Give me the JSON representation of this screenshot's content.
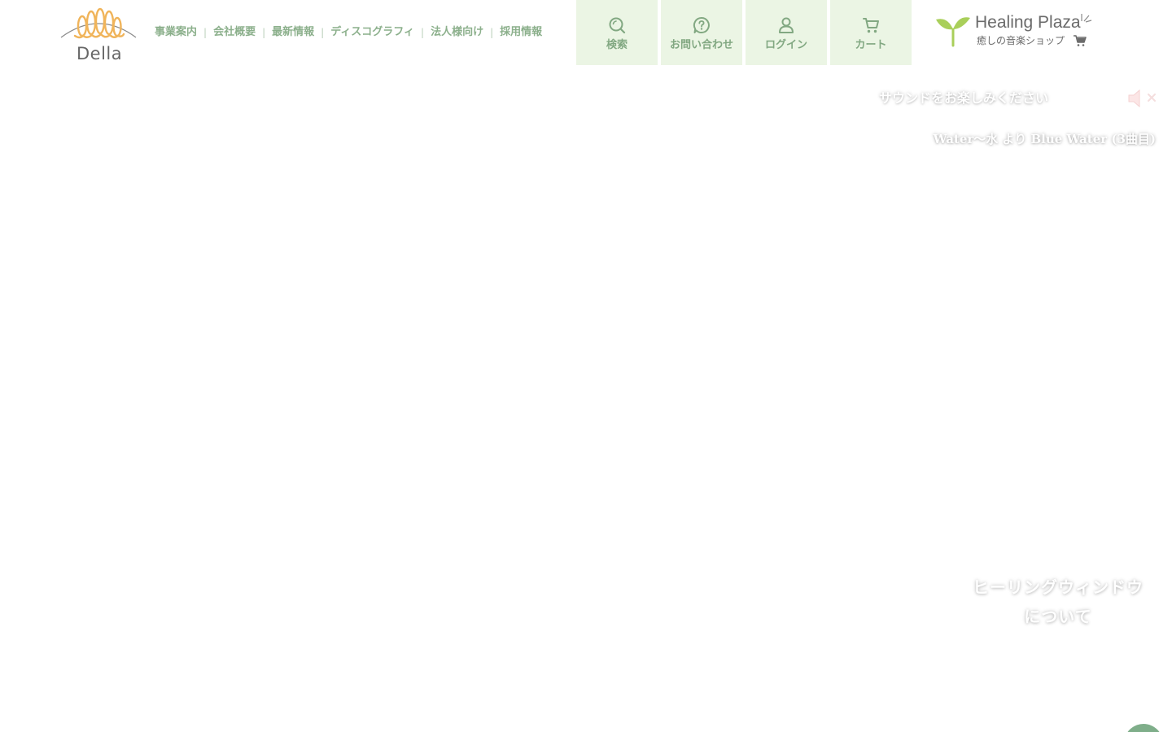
{
  "header": {
    "logo": {
      "text": "Della",
      "icon": "della-logo-swirl"
    },
    "nav": [
      {
        "label": "事業案内"
      },
      {
        "label": "会社概要"
      },
      {
        "label": "最新情報"
      },
      {
        "label": "ディスコグラフィ"
      },
      {
        "label": "法人様向け"
      },
      {
        "label": "採用情報"
      }
    ],
    "nav_separator": "|",
    "utility": [
      {
        "label": "検索",
        "icon": "search-icon"
      },
      {
        "label": "お問い合わせ",
        "icon": "question-icon"
      },
      {
        "label": "ログイン",
        "icon": "user-icon"
      },
      {
        "label": "カート",
        "icon": "cart-icon"
      }
    ],
    "healing_plaza": {
      "name": "Healing Plaza",
      "tagline": "癒しの音楽ショップ",
      "icon": "sprout-icon"
    }
  },
  "sound": {
    "prompt": "サウンドをお楽しみください",
    "toggle_icon": "speaker-muted-icon",
    "track_title": "Water〜水 より Blue Water (3曲目)"
  },
  "healing_window": {
    "line1": "ヒーリングウィンドウ",
    "line2": "について"
  },
  "page_top": {
    "icon": "arrow-up-icon"
  },
  "colors": {
    "nav_text": "#8cb08c",
    "util_bg": "#ebf5e4",
    "util_text": "#82a882",
    "logo_orange": "#f0b45a",
    "page_top_bg": "#7fae8a"
  }
}
